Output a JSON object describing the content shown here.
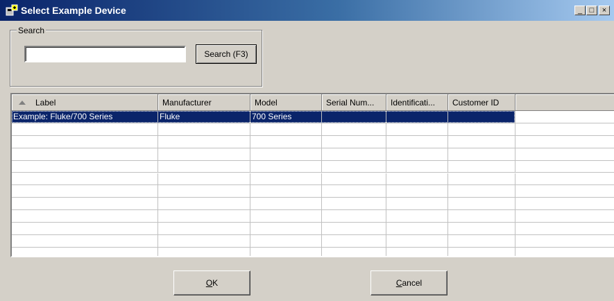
{
  "window": {
    "title": "Select Example Device",
    "controls": {
      "minimize": "_",
      "maximize": "□",
      "close": "×"
    }
  },
  "search": {
    "group_label": "Search",
    "input_value": "",
    "button_label": "Search (F3)"
  },
  "table": {
    "columns": [
      "Label",
      "Manufacturer",
      "Model",
      "Serial Num...",
      "Identificati...",
      "Customer ID"
    ],
    "rows": [
      [
        "Example: Fluke/700 Series",
        "Fluke",
        "700 Series",
        "",
        "",
        ""
      ]
    ],
    "selected_row": 0,
    "empty_rows": 11
  },
  "footer": {
    "ok": {
      "mnemonic": "O",
      "rest": "K"
    },
    "cancel": {
      "mnemonic": "C",
      "rest": "ancel"
    }
  }
}
